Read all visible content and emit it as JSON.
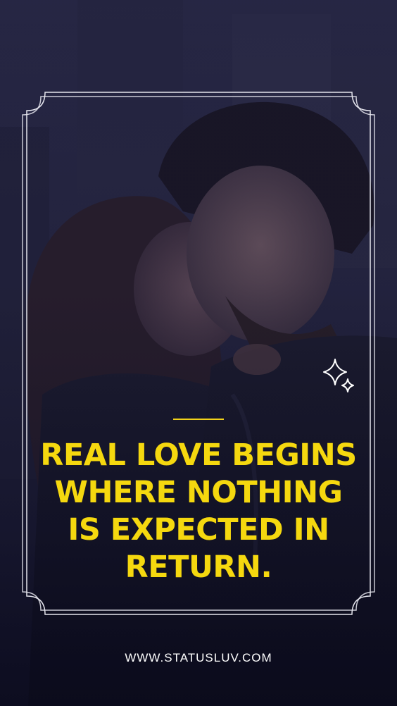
{
  "quote": {
    "lines": [
      "REAL LOVE BEGINS",
      "WHERE NOTHING",
      "IS EXPECTED IN",
      "RETURN."
    ]
  },
  "footer": {
    "website": "WWW.STATUSLUV.COM"
  },
  "colors": {
    "quote_text": "#f5d80f",
    "divider": "#f2d21a",
    "frame_stroke": "#e6e6ee",
    "footer_text": "#ffffff",
    "background_tint": "#14142a"
  },
  "icons": {
    "decoration": "sparkle-stars-icon"
  }
}
